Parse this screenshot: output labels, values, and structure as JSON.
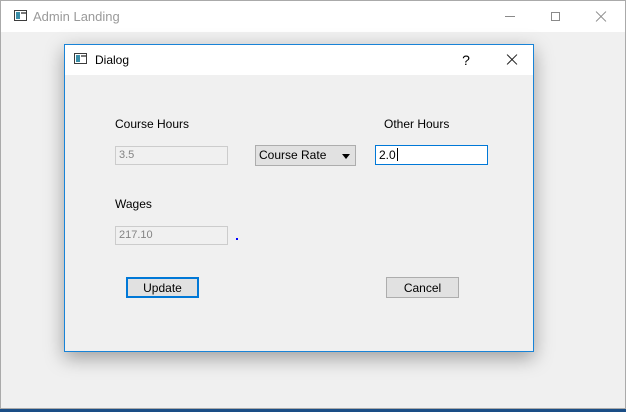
{
  "main_window": {
    "title": "Admin Landing"
  },
  "dialog": {
    "title": "Dialog",
    "help_label": "?",
    "course_hours": {
      "label": "Course Hours",
      "value": "3.5"
    },
    "rate_combo": {
      "selected": "Course Rate"
    },
    "other_hours": {
      "label": "Other Hours",
      "value": "2.0"
    },
    "wages": {
      "label": "Wages",
      "value": "217.10"
    },
    "buttons": {
      "update": "Update",
      "cancel": "Cancel"
    }
  },
  "icons": {
    "app": "app-window-icon",
    "minimize": "minimize-icon",
    "maximize": "maximize-icon",
    "close": "close-icon",
    "dropdown": "chevron-down-icon"
  },
  "colors": {
    "accent": "#0078d7",
    "dialog_border": "#1883d7",
    "desktop": "#1a4e86"
  }
}
